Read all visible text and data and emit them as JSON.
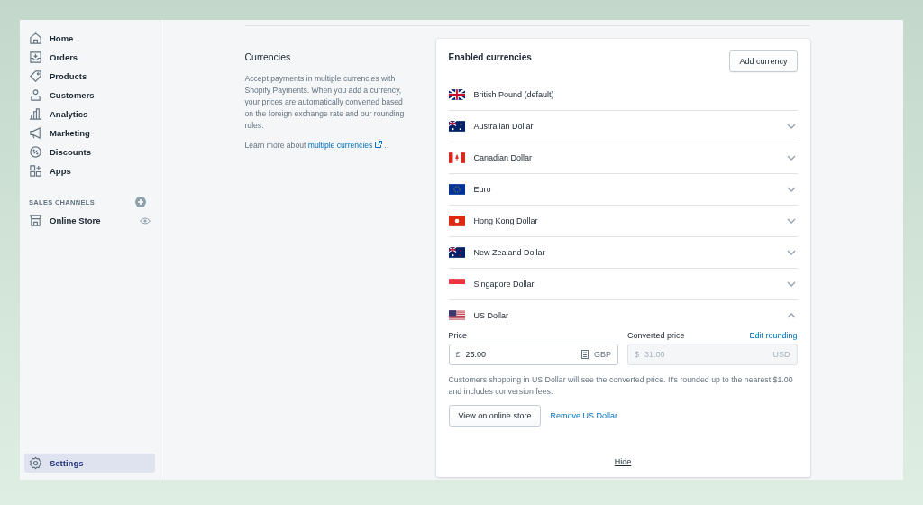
{
  "sidebar": {
    "items": [
      {
        "label": "Home",
        "selected": false
      },
      {
        "label": "Orders",
        "selected": false
      },
      {
        "label": "Products",
        "selected": false
      },
      {
        "label": "Customers",
        "selected": false
      },
      {
        "label": "Analytics",
        "selected": false
      },
      {
        "label": "Marketing",
        "selected": false
      },
      {
        "label": "Discounts",
        "selected": false
      },
      {
        "label": "Apps",
        "selected": false
      }
    ],
    "section_title": "SALES CHANNELS",
    "channels": [
      {
        "label": "Online Store",
        "selected": false
      }
    ],
    "footer": {
      "label": "Settings",
      "selected": true
    }
  },
  "intro": {
    "title": "Currencies",
    "text": "Accept payments in multiple currencies with Shopify Payments. When you add a currency, your prices are automatically converted based on the foreign exchange rate and our rounding rules.",
    "learn_prefix": "Learn more about",
    "learn_link": "multiple currencies",
    "learn_suffix": "."
  },
  "card": {
    "title": "Enabled currencies",
    "add_button": "Add currency",
    "currencies": [
      {
        "name": "British Pound (default)",
        "kind": "default",
        "expanded": false
      },
      {
        "name": "Australian Dollar",
        "kind": "toggle",
        "expanded": false
      },
      {
        "name": "Canadian Dollar",
        "kind": "toggle",
        "expanded": false
      },
      {
        "name": "Euro",
        "kind": "toggle",
        "expanded": false
      },
      {
        "name": "Hong Kong Dollar",
        "kind": "toggle",
        "expanded": false
      },
      {
        "name": "New Zealand Dollar",
        "kind": "toggle",
        "expanded": false
      },
      {
        "name": "Singapore Dollar",
        "kind": "toggle",
        "expanded": false
      },
      {
        "name": "US Dollar",
        "kind": "toggle",
        "expanded": true
      }
    ],
    "detail": {
      "price_label": "Price",
      "price_prefix": "£",
      "price_value": "25.00",
      "price_suffix": "GBP",
      "converted_label": "Converted price",
      "edit_link": "Edit rounding",
      "converted_prefix": "$",
      "converted_value": "31.00",
      "converted_suffix": "USD",
      "converted_disabled": true,
      "note": "Customers shopping in US Dollar will see the converted price. It's rounded up to the nearest $1.00 and includes conversion fees.",
      "view_button": "View on online store",
      "remove_link": "Remove US Dollar"
    },
    "hide_link": "Hide"
  }
}
